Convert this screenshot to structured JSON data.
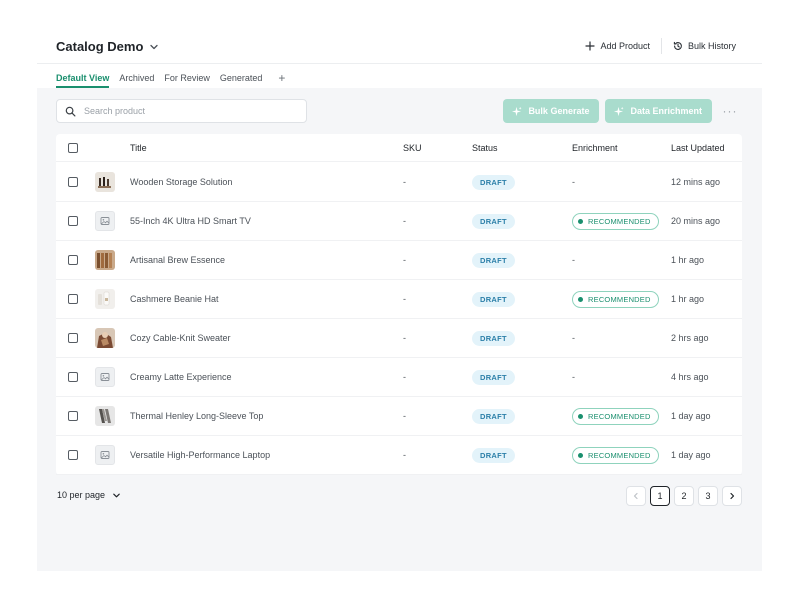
{
  "header": {
    "title": "Catalog Demo",
    "add_product": "Add Product",
    "bulk_history": "Bulk History"
  },
  "tabs": [
    {
      "label": "Default View",
      "active": true
    },
    {
      "label": "Archived",
      "active": false
    },
    {
      "label": "For Review",
      "active": false
    },
    {
      "label": "Generated",
      "active": false
    }
  ],
  "tab_add": "+",
  "search": {
    "placeholder": "Search product",
    "value": ""
  },
  "toolbar": {
    "bulk_generate": "Bulk Generate",
    "data_enrichment": "Data Enrichment",
    "more": "···"
  },
  "table": {
    "columns": {
      "title": "Title",
      "sku": "SKU",
      "status": "Status",
      "enrichment": "Enrichment",
      "last_updated": "Last Updated"
    },
    "rows": [
      {
        "thumb": "storage-photo",
        "title": "Wooden Storage Solution",
        "sku": "-",
        "status": "DRAFT",
        "enrichment": "-",
        "last_updated": "12 mins ago"
      },
      {
        "thumb": "image-placeholder-icon",
        "title": "55-Inch 4K Ultra HD Smart TV",
        "sku": "-",
        "status": "DRAFT",
        "enrichment": "RECOMMENDED",
        "last_updated": "20 mins ago"
      },
      {
        "thumb": "brew-photo",
        "title": "Artisanal Brew Essence",
        "sku": "-",
        "status": "DRAFT",
        "enrichment": "-",
        "last_updated": "1 hr ago"
      },
      {
        "thumb": "beanie-photo",
        "title": "Cashmere Beanie Hat",
        "sku": "-",
        "status": "DRAFT",
        "enrichment": "RECOMMENDED",
        "last_updated": "1 hr ago"
      },
      {
        "thumb": "sweater-photo",
        "title": "Cozy Cable-Knit Sweater",
        "sku": "-",
        "status": "DRAFT",
        "enrichment": "-",
        "last_updated": "2 hrs ago"
      },
      {
        "thumb": "image-placeholder-icon",
        "title": "Creamy Latte Experience",
        "sku": "-",
        "status": "DRAFT",
        "enrichment": "-",
        "last_updated": "4 hrs ago"
      },
      {
        "thumb": "henley-photo",
        "title": "Thermal Henley Long-Sleeve Top",
        "sku": "-",
        "status": "DRAFT",
        "enrichment": "RECOMMENDED",
        "last_updated": "1 day ago"
      },
      {
        "thumb": "image-placeholder-icon",
        "title": "Versatile High-Performance Laptop",
        "sku": "-",
        "status": "DRAFT",
        "enrichment": "RECOMMENDED",
        "last_updated": "1 day ago"
      }
    ]
  },
  "footer": {
    "per_page": "10 per page",
    "pages": [
      "1",
      "2",
      "3"
    ],
    "current_page": "1"
  },
  "colors": {
    "accent": "#1a8f6e",
    "accent_light": "#a9dccd",
    "draft_bg": "#e3f3fa",
    "draft_text": "#2b7fa8",
    "content_bg": "#f5f6f8"
  }
}
